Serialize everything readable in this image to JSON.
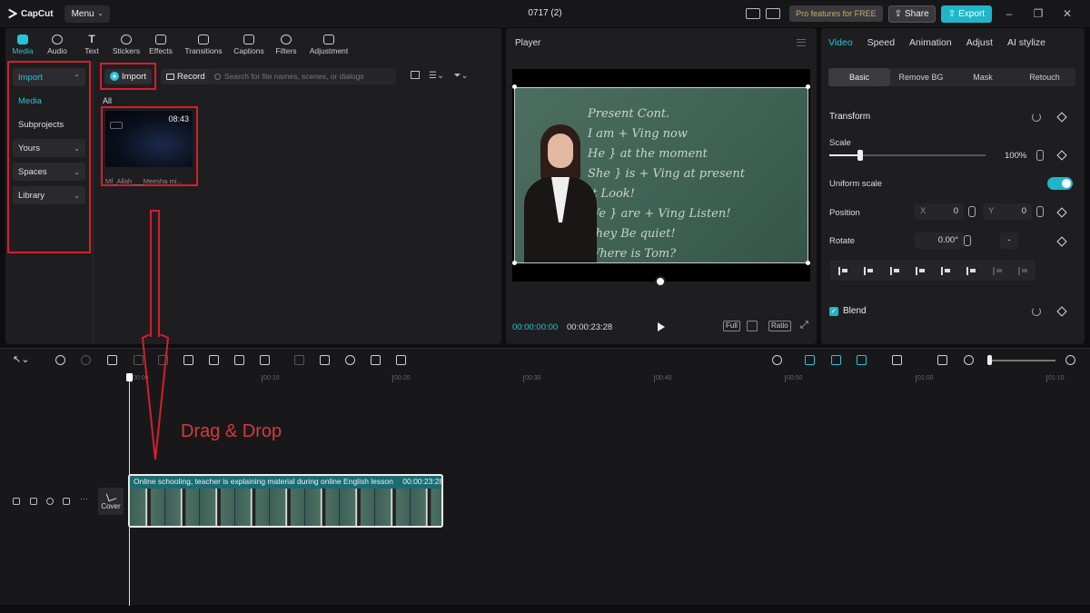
{
  "app": {
    "name": "CapCut",
    "menu_label": "Menu",
    "project_title": "0717 (2)",
    "pro_label": "Pro features for FREE",
    "share_label": "Share",
    "export_label": "Export"
  },
  "media_tabs": [
    {
      "label": "Media",
      "icon": "media-icon"
    },
    {
      "label": "Audio",
      "icon": "audio-icon"
    },
    {
      "label": "Text",
      "icon": "text-icon"
    },
    {
      "label": "Stickers",
      "icon": "stickers-icon"
    },
    {
      "label": "Effects",
      "icon": "effects-icon"
    },
    {
      "label": "Transitions",
      "icon": "transitions-icon"
    },
    {
      "label": "Captions",
      "icon": "captions-icon"
    },
    {
      "label": "Filters",
      "icon": "filters-icon"
    },
    {
      "label": "Adjustment",
      "icon": "adjustment-icon"
    }
  ],
  "side_nav": {
    "import": "Import",
    "media": "Media",
    "subprojects": "Subprojects",
    "yours": "Yours",
    "spaces": "Spaces",
    "library": "Library"
  },
  "media_toolbar": {
    "import_label": "Import",
    "record_label": "Record",
    "search_placeholder": "Search for file names, scenes, or dialogs"
  },
  "media_grid": {
    "filter_label": "All",
    "items": [
      {
        "name": "Mf_Allah___Meesha mi...",
        "duration": "08:43"
      }
    ]
  },
  "player": {
    "title": "Player",
    "current_time": "00:00:00:00",
    "total_time": "00:00:23:28",
    "full_label": "Full",
    "ratio_label": "Ratio",
    "board_lines": [
      "Present Cont.",
      "I am + Ving   now",
      "He }        at the moment",
      "She } is + Ving  at present",
      "It                Look!",
      "We } are + Ving  Listen!",
      "They            Be quiet!",
      "                Where is Tom?"
    ]
  },
  "properties": {
    "tabs": [
      "Video",
      "Speed",
      "Animation",
      "Adjust",
      "AI stylize"
    ],
    "sub_tabs": [
      "Basic",
      "Remove BG",
      "Mask",
      "Retouch"
    ],
    "transform_label": "Transform",
    "scale_label": "Scale",
    "scale_value": "100%",
    "scale_fraction": 0.2,
    "uniform_scale_label": "Uniform scale",
    "position_label": "Position",
    "pos_x_label": "X",
    "pos_x_value": "0",
    "pos_y_label": "Y",
    "pos_y_value": "0",
    "rotate_label": "Rotate",
    "rotate_value": "0.00°",
    "rotate_extra": "-",
    "blend_label": "Blend"
  },
  "timeline": {
    "ruler_ticks": [
      "00:00",
      "00:10",
      "00:20",
      "00:30",
      "00:40",
      "00:50",
      "01:00",
      "01:10"
    ],
    "cover_label": "Cover",
    "clip_title": "Online schooling, teacher is explaining material during online English lesson",
    "clip_duration": "00:00:23:28"
  },
  "annotation": {
    "drag_text": "Drag & Drop",
    "color": "#d41f2b"
  },
  "colors": {
    "accent": "#25c4d6",
    "export": "#1fb6c9",
    "highlight": "#d41f2b"
  }
}
